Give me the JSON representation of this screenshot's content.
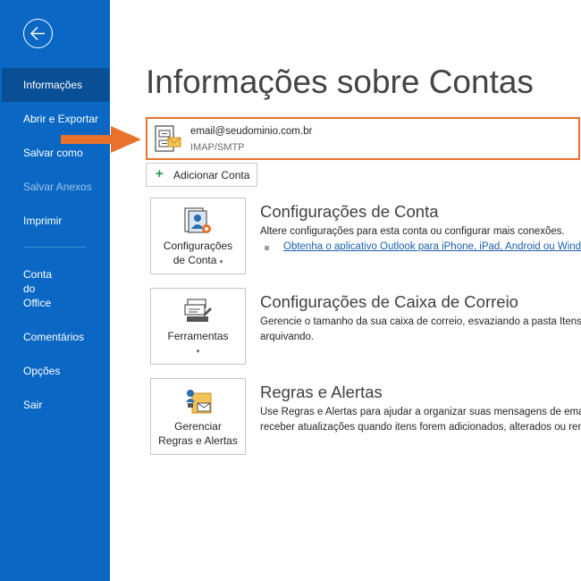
{
  "sidebar": {
    "back_icon": "back-arrow-icon",
    "items": [
      {
        "label": "Informações",
        "state": "active"
      },
      {
        "label": "Abrir e Exportar"
      },
      {
        "label": "Salvar como"
      },
      {
        "label": "Salvar Anexos",
        "state": "disabled"
      },
      {
        "label": "Imprimir"
      },
      {
        "label": "Conta\ndo\nOffice"
      },
      {
        "label": "Comentários"
      },
      {
        "label": "Opções"
      },
      {
        "label": "Sair"
      }
    ]
  },
  "main": {
    "title": "Informações sobre Contas",
    "account": {
      "email": "email@seudominio.com.br",
      "type": "IMAP/SMTP"
    },
    "add_account_label": "Adicionar Conta",
    "sections": [
      {
        "tile_label": "Configurações\nde Conta",
        "title": "Configurações de Conta",
        "description": "Altere configurações para esta conta ou configurar mais conexões.",
        "link": "Obtenha o aplicativo Outlook para iPhone, iPad, Android ou Windows"
      },
      {
        "tile_label": "Ferramentas",
        "title": "Configurações de Caixa de Correio",
        "description_lines": [
          "Gerencie o tamanho da sua caixa de correio, esvaziando a pasta Itens Excluídos e",
          "arquivando."
        ]
      },
      {
        "tile_label": "Gerenciar\nRegras e Alertas",
        "title": "Regras e Alertas",
        "description_lines": [
          "Use Regras e Alertas para ajudar a organizar suas mensagens de email recebidas e",
          "receber atualizações quando itens forem adicionados, alterados ou removidos."
        ]
      }
    ]
  },
  "colors": {
    "sidebar_bg": "#0a68c4",
    "sidebar_active": "#094f96",
    "highlight": "#e8722b",
    "link": "#1b5fae"
  }
}
